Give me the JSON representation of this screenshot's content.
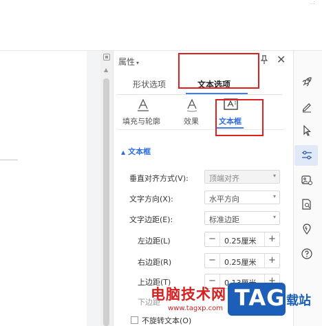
{
  "top_mark": "..:",
  "panel": {
    "title": "属性",
    "title_caret": "▾",
    "pin_icon": "pin-icon",
    "close_label": "✕"
  },
  "tabs": [
    {
      "label": "形状选项",
      "active": false
    },
    {
      "label": "文本选项",
      "active": true
    }
  ],
  "subtabs": [
    {
      "label": "填充与轮廓",
      "icon": "text-fill-icon",
      "active": false
    },
    {
      "label": "效果",
      "icon": "text-effect-icon",
      "active": false
    },
    {
      "label": "文本框",
      "icon": "textbox-icon",
      "active": true
    }
  ],
  "section": {
    "title": "文本框",
    "toggle": "▲"
  },
  "fields": {
    "vertical_align": {
      "label": "垂直对齐方式(V):",
      "value": "顶端对齐"
    },
    "text_direction": {
      "label": "文字方向(X):",
      "value": "水平方向"
    },
    "text_margin": {
      "label": "文字边距(E):",
      "value": "标准边距"
    },
    "left_margin": {
      "label": "左边距(L)",
      "value": "0.25厘米"
    },
    "right_margin": {
      "label": "右边距(R)",
      "value": "0.25厘米"
    },
    "top_margin": {
      "label": "上边距(T)",
      "value": "0.13厘米"
    },
    "bottom_margin": {
      "label": "下边距"
    }
  },
  "stepper_minus": "−",
  "stepper_plus": "+",
  "dropdown_arrow": "▾",
  "checkbox": {
    "label": "不旋转文本(O)",
    "checked": false
  },
  "right_rail": [
    "rocket-icon",
    "pen-icon",
    "cursor-icon",
    "sliders-icon",
    "image-effects-icon",
    "doc-search-icon",
    "location-icon",
    "help-icon"
  ],
  "watermark": {
    "cn": "电脑技术网",
    "url": "www.tagxp.com",
    "logo": "TAG",
    "suffix": "载站"
  },
  "colors": {
    "accent": "#2d6ce8",
    "highlight": "#e02020",
    "logo": "#1d5fb8"
  }
}
